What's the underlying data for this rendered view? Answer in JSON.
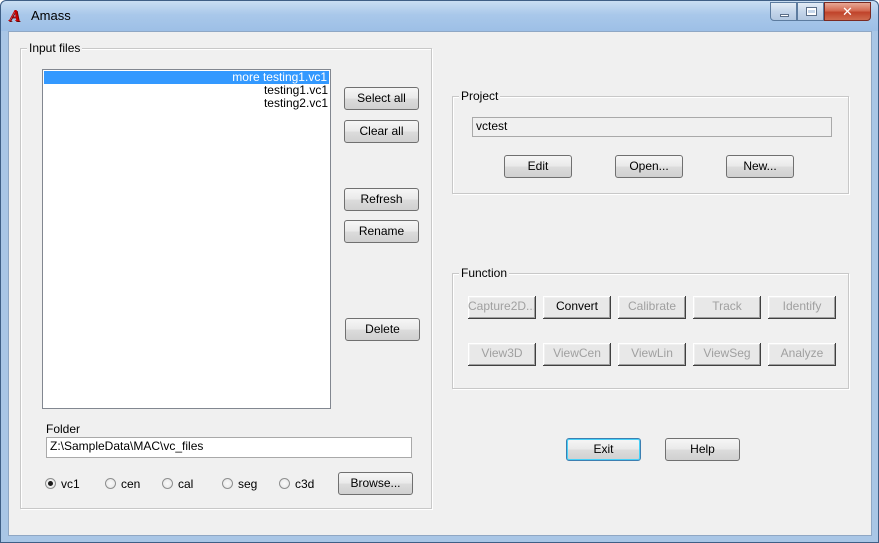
{
  "window": {
    "title": "Amass",
    "close_glyph": "✕"
  },
  "input_files": {
    "group_label": "Input files",
    "files": [
      {
        "name": "more testing1.vc1",
        "selected": true
      },
      {
        "name": "testing1.vc1",
        "selected": false
      },
      {
        "name": "testing2.vc1",
        "selected": false
      }
    ],
    "select_all_label": "Select all",
    "clear_all_label": "Clear all",
    "refresh_label": "Refresh",
    "rename_label": "Rename",
    "delete_label": "Delete",
    "folder_label": "Folder",
    "folder_path": "Z:\\SampleData\\MAC\\vc_files",
    "browse_label": "Browse...",
    "file_types": [
      {
        "label": "vc1",
        "checked": true
      },
      {
        "label": "cen",
        "checked": false
      },
      {
        "label": "cal",
        "checked": false
      },
      {
        "label": "seg",
        "checked": false
      },
      {
        "label": "c3d",
        "checked": false
      }
    ]
  },
  "project": {
    "group_label": "Project",
    "name": "vctest",
    "edit_label": "Edit",
    "open_label": "Open...",
    "new_label": "New..."
  },
  "function": {
    "group_label": "Function",
    "row1": [
      {
        "label": "Capture2D...",
        "enabled": false
      },
      {
        "label": "Convert",
        "enabled": true
      },
      {
        "label": "Calibrate",
        "enabled": false
      },
      {
        "label": "Track",
        "enabled": false
      },
      {
        "label": "Identify",
        "enabled": false
      }
    ],
    "row2": [
      {
        "label": "View3D",
        "enabled": false
      },
      {
        "label": "ViewCen",
        "enabled": false
      },
      {
        "label": "ViewLin",
        "enabled": false
      },
      {
        "label": "ViewSeg",
        "enabled": false
      },
      {
        "label": "Analyze",
        "enabled": false
      }
    ]
  },
  "footer": {
    "exit_label": "Exit",
    "help_label": "Help"
  }
}
